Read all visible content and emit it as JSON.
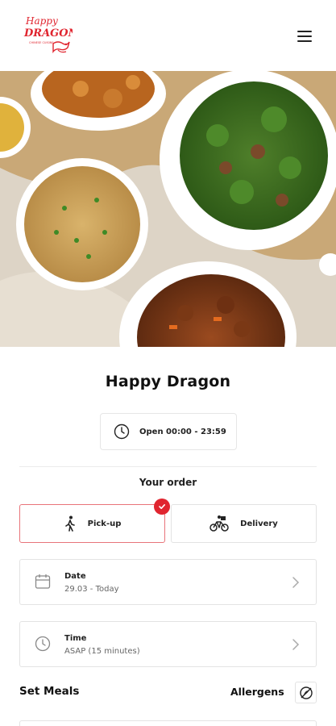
{
  "header": {
    "logo_text_line1": "Happy",
    "logo_text_line2": "DRAGON",
    "logo_tagline": "CHINESE CUISINE",
    "menu_icon": "hamburger-menu-icon"
  },
  "hero": {
    "image": "food-photo"
  },
  "restaurant": {
    "name": "Happy Dragon",
    "hours": "Open 00:00 - 23:59",
    "hours_icon": "clock-icon"
  },
  "order": {
    "heading": "Your order",
    "modes": {
      "pickup": {
        "label": "Pick-up",
        "icon": "walking-person-icon",
        "selected": true
      },
      "delivery": {
        "label": "Delivery",
        "icon": "bicycle-courier-icon",
        "selected": false
      }
    },
    "date": {
      "label": "Date",
      "value": "29.03 - Today",
      "icon": "calendar-icon"
    },
    "time": {
      "label": "Time",
      "value": "ASAP (15 minutes)",
      "icon": "clock-icon"
    }
  },
  "menu": {
    "section_title": "Set Meals",
    "allergens_label": "Allergens",
    "allergens_icon": "allergen-filter-icon"
  },
  "colors": {
    "accent": "#e0252f",
    "border": "#e3e3e3"
  }
}
